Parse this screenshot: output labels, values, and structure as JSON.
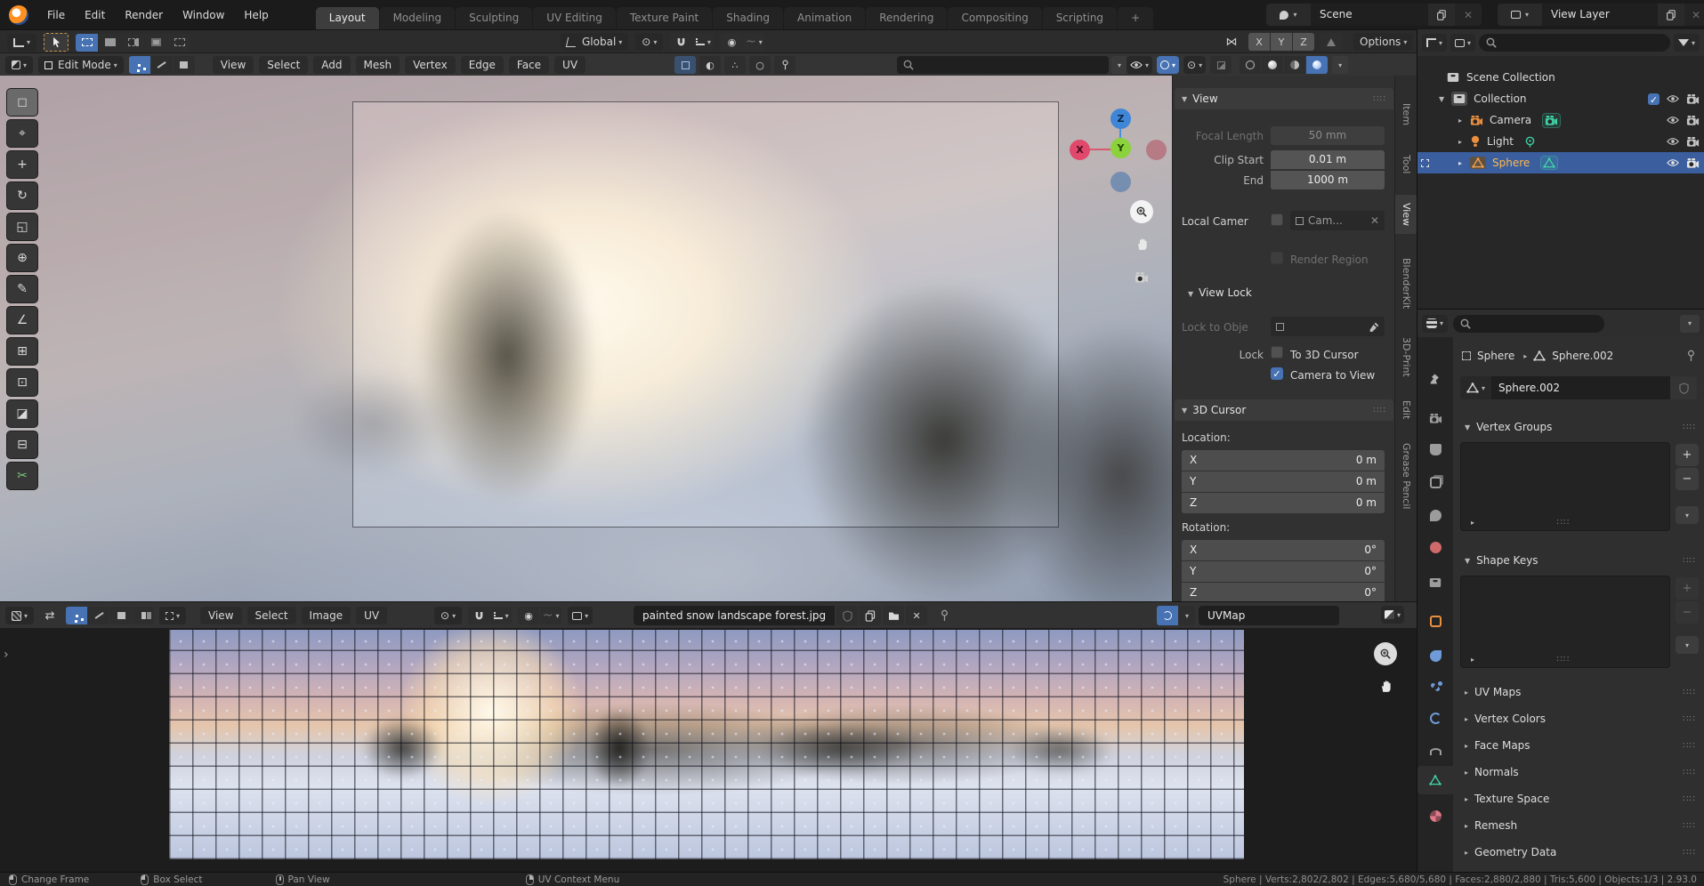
{
  "icons": {
    "dd": "▾",
    "ddr": "▸",
    "exp": "▼",
    "play": "▶",
    "check": "✓",
    "close": "✕",
    "plus": "+",
    "minus": "−",
    "grip": "∷∷",
    "chevr": "›",
    "sync": "⇄",
    "target": "⊙",
    "circle": "◉",
    "half": "◐",
    "ring": "○",
    "tilde": "~",
    "dots": "∴"
  },
  "colors": {
    "accent": "#4772b3",
    "object_orange": "#eb8f3f",
    "data_green": "#3fd0a4",
    "selection_blue": "#3a5e9e",
    "active_object_text": "#ffb84d",
    "axis_x": "#e0486c",
    "axis_y": "#8bd23c",
    "axis_z": "#4086d6"
  },
  "topbar": {
    "menus": [
      "File",
      "Edit",
      "Render",
      "Window",
      "Help"
    ],
    "tabs": [
      "Layout",
      "Modeling",
      "Sculpting",
      "UV Editing",
      "Texture Paint",
      "Shading",
      "Animation",
      "Rendering",
      "Compositing",
      "Scripting"
    ],
    "active_tab": "Layout",
    "add_tab": "+",
    "scene_label": "Scene",
    "view_layer_label": "View Layer"
  },
  "tool_settings": {
    "orientation": "Global",
    "mirror_x": "X",
    "mirror_y": "Y",
    "mirror_z": "Z",
    "options_label": "Options"
  },
  "viewport": {
    "mode": "Edit Mode",
    "menus": [
      "View",
      "Select",
      "Add",
      "Mesh",
      "Vertex",
      "Edge",
      "Face",
      "UV"
    ],
    "gizmo": {
      "x": "X",
      "y": "Y",
      "z": "Z"
    },
    "toolbar_tools": [
      "select-box",
      "cursor",
      "move",
      "rotate",
      "scale",
      "transform",
      "annotate",
      "measure",
      "extrude-region",
      "inset-faces",
      "bevel",
      "loop-cut",
      "knife"
    ],
    "toolbar_glyphs": [
      "◻",
      "⌖",
      "+",
      "↻",
      "◱",
      "⊕",
      "✎",
      "∠",
      "⊞",
      "⊡",
      "◪",
      "⊟",
      "✂"
    ]
  },
  "sidebar": {
    "tabs": [
      "Item",
      "Tool",
      "View",
      "BlenderKit",
      "3D-Print",
      "Edit",
      "Grease Pencil"
    ],
    "active_tab": "View",
    "view": {
      "title": "View",
      "focal_label": "Focal Length",
      "focal_value": "50 mm",
      "clip_start_label": "Clip Start",
      "clip_start_value": "0.01 m",
      "clip_end_label": "End",
      "clip_end_value": "1000 m",
      "local_camera_label": "Local Camer",
      "local_camera_value": "Cam...",
      "render_region_label": "Render Region",
      "view_lock_title": "View Lock",
      "lock_to_object_label": "Lock to Obje",
      "lock_label": "Lock",
      "to_3d_cursor_label": "To 3D Cursor",
      "camera_to_view_label": "Camera to View"
    },
    "cursor": {
      "title": "3D Cursor",
      "location_label": "Location:",
      "rotation_label": "Rotation:",
      "loc": [
        {
          "axis": "X",
          "value": "0 m"
        },
        {
          "axis": "Y",
          "value": "0 m"
        },
        {
          "axis": "Z",
          "value": "0 m"
        }
      ],
      "rot": [
        {
          "axis": "X",
          "value": "0°"
        },
        {
          "axis": "Y",
          "value": "0°"
        },
        {
          "axis": "Z",
          "value": "0°"
        }
      ]
    }
  },
  "outliner": {
    "rows": [
      {
        "label": "Scene Collection"
      },
      {
        "label": "Collection"
      },
      {
        "label": "Camera"
      },
      {
        "label": "Light"
      },
      {
        "label": "Sphere",
        "selected": true
      }
    ]
  },
  "properties": {
    "breadcrumb_object": "Sphere",
    "breadcrumb_data": "Sphere.002",
    "name_value": "Sphere.002",
    "vertex_groups_title": "Vertex Groups",
    "shape_keys_title": "Shape Keys",
    "collapsed_panels": [
      "UV Maps",
      "Vertex Colors",
      "Face Maps",
      "Normals",
      "Texture Space",
      "Remesh",
      "Geometry Data"
    ],
    "tab_icons": [
      "tool",
      "render",
      "output",
      "view-layer",
      "scene",
      "world",
      "collection",
      "object",
      "modifiers",
      "particles",
      "physics",
      "constraints",
      "object-data",
      "material"
    ],
    "active_tab_icon": "object-data"
  },
  "uv_editor": {
    "menus": [
      "View",
      "Select",
      "Image",
      "UV"
    ],
    "image_name": "painted snow landscape forest.jpg",
    "uv_map_name": "UVMap"
  },
  "status_bar": {
    "items": [
      "Change Frame",
      "Box Select",
      "Pan View",
      "UV Context Menu"
    ],
    "stats": "Sphere | Verts:2,802/2,802 | Edges:5,680/5,680 | Faces:2,880/2,880 | Tris:5,600 | Objects:1/3 | 2.93.0"
  }
}
